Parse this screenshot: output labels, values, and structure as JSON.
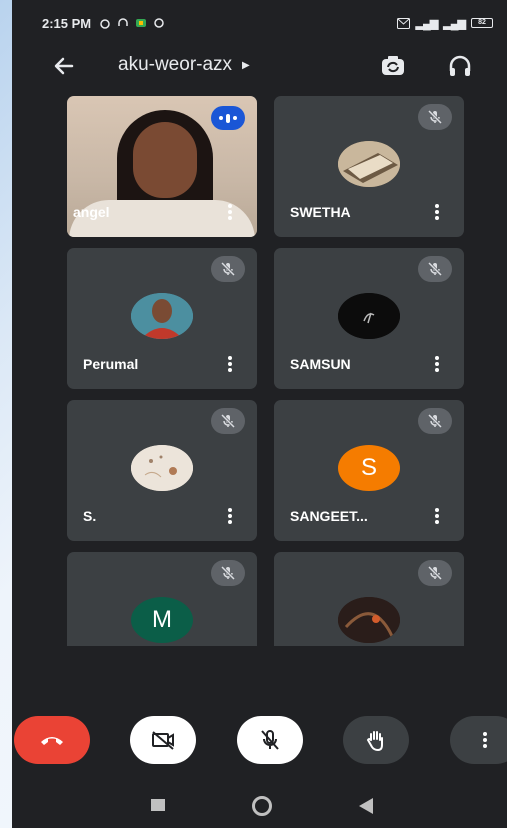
{
  "status_bar": {
    "time": "2:15 PM",
    "battery": "82"
  },
  "header": {
    "meeting_code": "aku-weor-azx"
  },
  "participants": [
    {
      "name": "angel",
      "state": "speaking",
      "avatar_type": "video"
    },
    {
      "name": "SWETHA",
      "state": "muted",
      "avatar_type": "photo",
      "avatar_color": "#a98e6b"
    },
    {
      "name": "Perumal",
      "state": "muted",
      "avatar_type": "photo",
      "avatar_color": "#4c8fa0"
    },
    {
      "name": "SAMSUN",
      "state": "muted",
      "avatar_type": "photo",
      "avatar_color": "#111111"
    },
    {
      "name": "S.",
      "state": "muted",
      "avatar_type": "photo",
      "avatar_color": "#e7ddd2"
    },
    {
      "name": "SANGEET...",
      "state": "muted",
      "avatar_type": "letter",
      "letter": "S",
      "avatar_color": "#f57c00"
    },
    {
      "name": "",
      "state": "muted",
      "avatar_type": "letter",
      "letter": "M",
      "avatar_color": "#0b5e48"
    },
    {
      "name": "",
      "state": "muted",
      "avatar_type": "photo",
      "avatar_color": "#2a1d1a"
    }
  ],
  "colors": {
    "end_call": "#ea4335",
    "speaking_badge": "#1a56d6",
    "tile_bg": "#3c4043",
    "background": "#202124"
  }
}
